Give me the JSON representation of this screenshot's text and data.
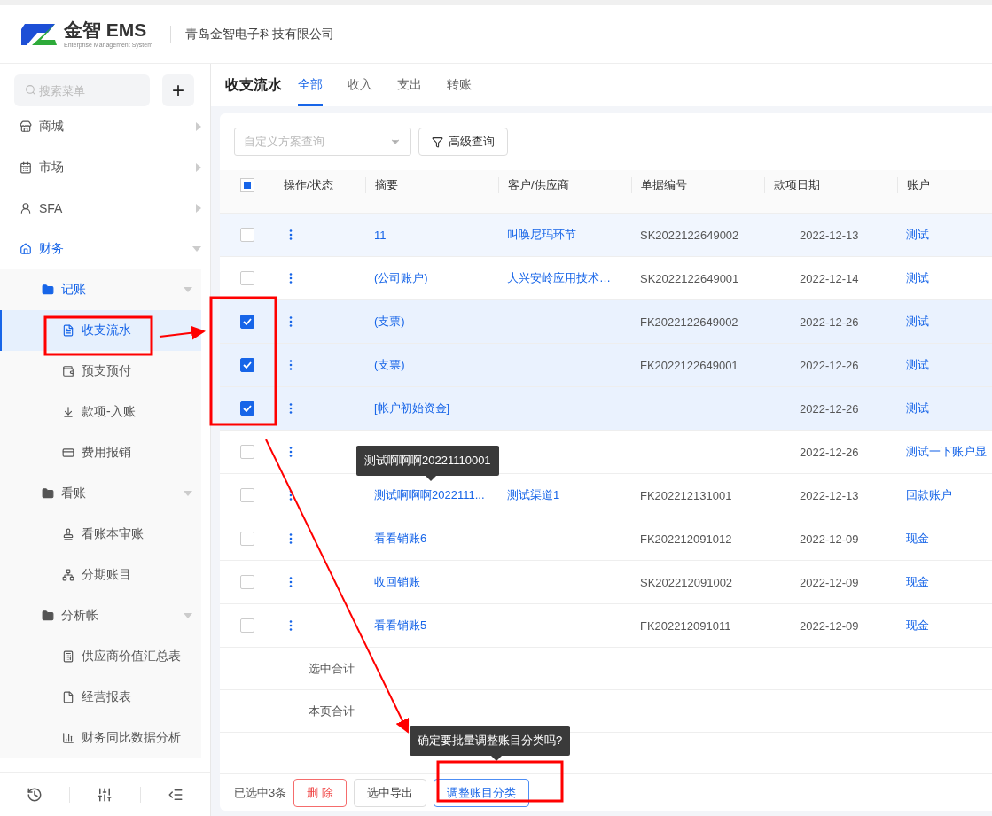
{
  "header": {
    "logo_text": "金智 EMS",
    "logo_subtitle": "Enterprise Management System",
    "company": "青岛金智电子科技有限公司"
  },
  "sidebar": {
    "search": {
      "placeholder": "搜索菜单"
    },
    "add_button": "+",
    "items": [
      {
        "label": "商城",
        "kind": "group",
        "expanded": false,
        "selected": false
      },
      {
        "label": "市场",
        "kind": "group",
        "expanded": false,
        "selected": false
      },
      {
        "label": "SFA",
        "kind": "group",
        "expanded": false,
        "selected": false
      },
      {
        "label": "财务",
        "kind": "group",
        "expanded": true,
        "selected": true,
        "children": [
          {
            "label": "记账",
            "kind": "folder",
            "expanded": true,
            "selected": true,
            "children": [
              {
                "label": "收支流水",
                "kind": "page",
                "selected": true
              },
              {
                "label": "预支预付",
                "kind": "page",
                "selected": false
              },
              {
                "label": "款项-入账",
                "kind": "page",
                "selected": false
              },
              {
                "label": "费用报销",
                "kind": "page",
                "selected": false
              }
            ]
          },
          {
            "label": "看账",
            "kind": "folder",
            "expanded": true,
            "selected": false,
            "children": [
              {
                "label": "看账本审账",
                "kind": "page",
                "selected": false
              },
              {
                "label": "分期账目",
                "kind": "page",
                "selected": false
              }
            ]
          },
          {
            "label": "分析帐",
            "kind": "folder",
            "expanded": true,
            "selected": false,
            "children": [
              {
                "label": "供应商价值汇总表",
                "kind": "page",
                "selected": false
              },
              {
                "label": "经营报表",
                "kind": "page",
                "selected": false
              },
              {
                "label": "财务同比数据分析",
                "kind": "page",
                "selected": false
              }
            ]
          }
        ]
      }
    ]
  },
  "page": {
    "title": "收支流水",
    "tabs": [
      {
        "label": "全部",
        "selected": true
      },
      {
        "label": "收入",
        "selected": false
      },
      {
        "label": "支出",
        "selected": false
      },
      {
        "label": "转账",
        "selected": false
      }
    ],
    "scheme_select": {
      "placeholder": "自定义方案查询"
    },
    "advanced_button": "高级查询",
    "table": {
      "header_checkbox": {
        "indeterminate": true
      },
      "columns": [
        "操作/状态",
        "摘要",
        "客户/供应商",
        "单据编号",
        "款项日期",
        "账户"
      ],
      "rows": [
        {
          "selected": false,
          "hovered": true,
          "summary": "11",
          "customer": "叫唤尼玛环节",
          "number": "SK2022122649002",
          "date": "2022-12-13",
          "account": "测试"
        },
        {
          "selected": false,
          "hovered": false,
          "summary": "(公司账户)",
          "customer": "大兴安岭应用技术…",
          "number": "SK2022122649001",
          "date": "2022-12-14",
          "account": "测试"
        },
        {
          "selected": true,
          "hovered": false,
          "summary": "(支票)",
          "customer": "",
          "number": "FK2022122649002",
          "date": "2022-12-26",
          "account": "测试"
        },
        {
          "selected": true,
          "hovered": false,
          "summary": "(支票)",
          "customer": "",
          "number": "FK2022122649001",
          "date": "2022-12-26",
          "account": "测试"
        },
        {
          "selected": true,
          "hovered": false,
          "summary": "[帐户初始资金]",
          "customer": "",
          "number": "",
          "date": "2022-12-26",
          "account": "测试"
        },
        {
          "selected": false,
          "hovered": false,
          "summary": "",
          "customer": "",
          "number": "",
          "date": "2022-12-26",
          "account": "测试一下账户显"
        },
        {
          "selected": false,
          "hovered": false,
          "summary": "测试啊啊啊2022111...",
          "customer": "测试渠道1",
          "number": "FK202212131001",
          "date": "2022-12-13",
          "account": "回款账户"
        },
        {
          "selected": false,
          "hovered": false,
          "summary": "看看销账6",
          "customer": "",
          "number": "FK202212091012",
          "date": "2022-12-09",
          "account": "现金"
        },
        {
          "selected": false,
          "hovered": false,
          "summary": "收回销账",
          "customer": "",
          "number": "SK202212091002",
          "date": "2022-12-09",
          "account": "现金"
        },
        {
          "selected": false,
          "hovered": false,
          "summary": "看看销账5",
          "customer": "",
          "number": "FK202212091011",
          "date": "2022-12-09",
          "account": "现金"
        }
      ],
      "totals": [
        "选中合计",
        "本页合计"
      ]
    },
    "row_tooltip": "测试啊啊啊20221110001",
    "footer": {
      "selected_count": "已选中3条",
      "buttons": [
        {
          "label": "删 除",
          "kind": "danger"
        },
        {
          "label": "选中导出",
          "kind": "default"
        },
        {
          "label": "调整账目分类",
          "kind": "primary"
        }
      ],
      "confirm_tooltip": "确定要批量调整账目分类吗?"
    }
  }
}
